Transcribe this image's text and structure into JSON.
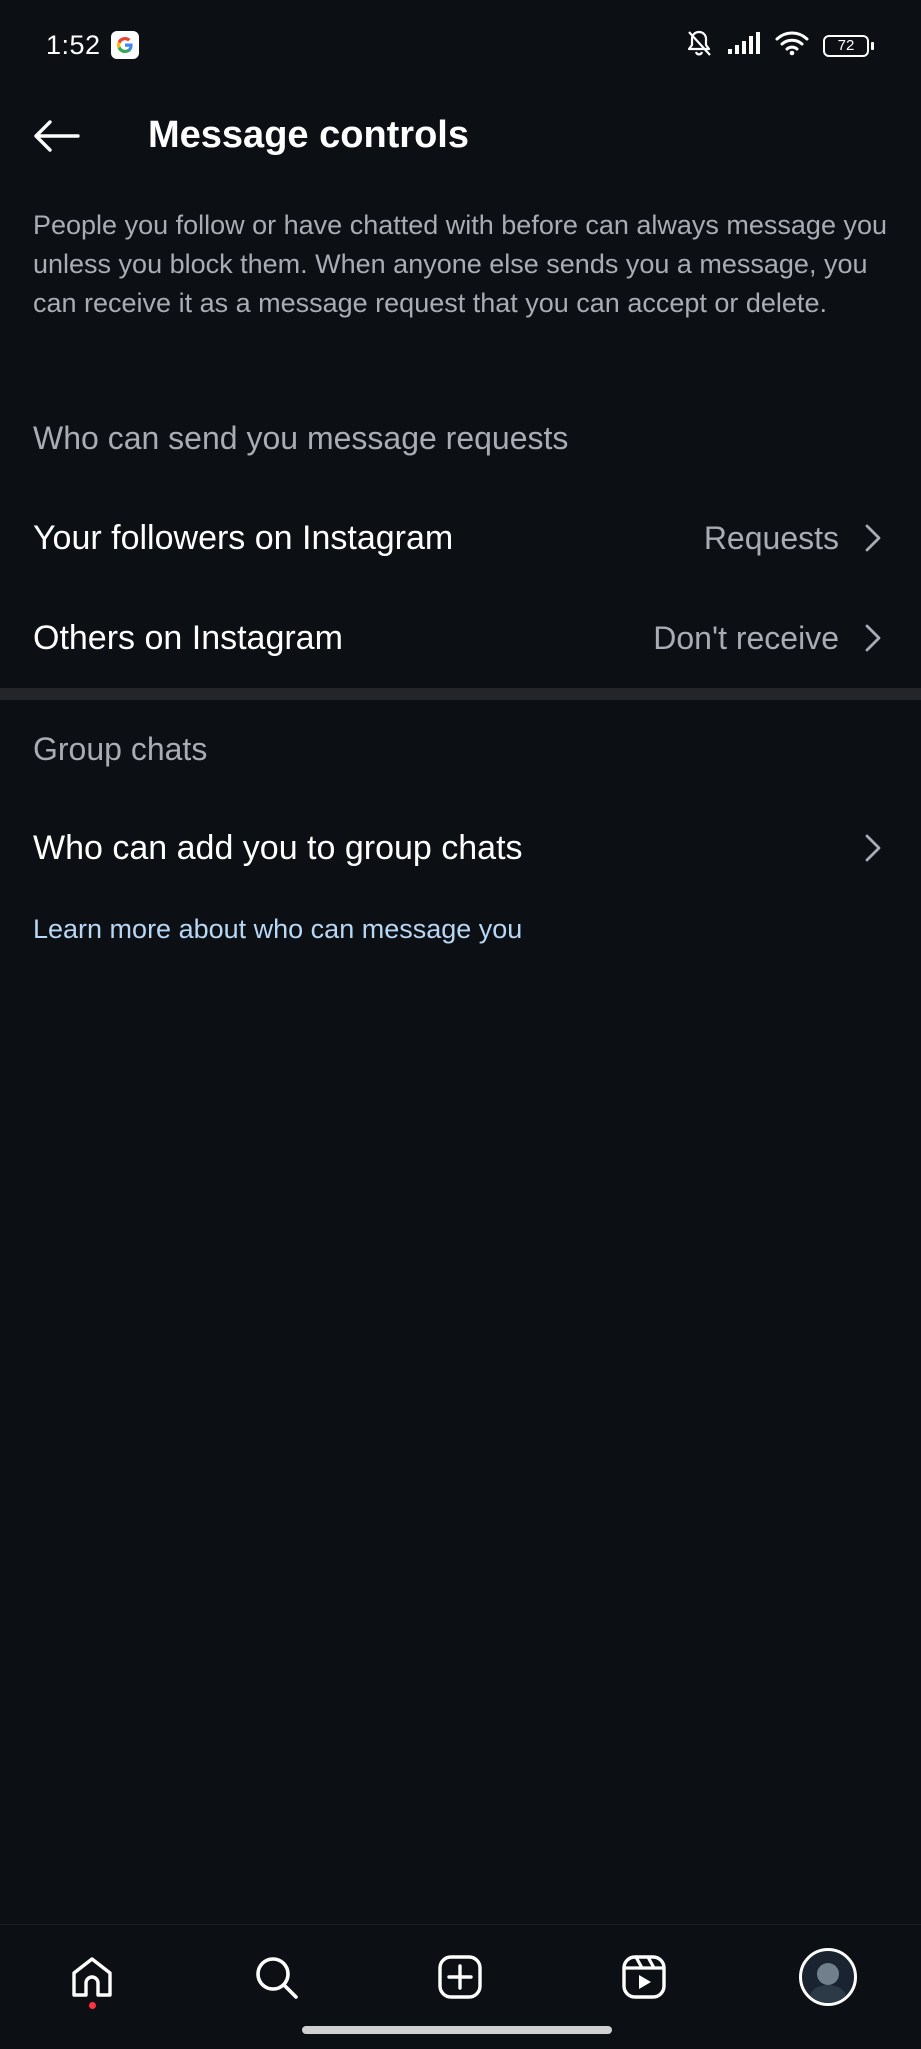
{
  "status_bar": {
    "time": "1:52",
    "battery": "72",
    "google_letter": "G"
  },
  "header": {
    "title": "Message controls"
  },
  "description": "People you follow or have chatted with before can always message you unless you block them. When anyone else sends you a message, you can receive it as a message request that you can accept or delete.",
  "section_requests": {
    "heading": "Who can send you message requests",
    "rows": [
      {
        "label": "Your followers on Instagram",
        "value": "Requests"
      },
      {
        "label": "Others on Instagram",
        "value": "Don't receive"
      }
    ]
  },
  "section_groups": {
    "heading": "Group chats",
    "rows": [
      {
        "label": "Who can add you to group chats",
        "value": ""
      }
    ]
  },
  "learn_more": "Learn more about who can message you",
  "nav": {
    "items": [
      "home-icon",
      "search-icon",
      "create-icon",
      "reels-icon",
      "profile-avatar"
    ]
  },
  "colors": {
    "background": "#0c0f14",
    "secondary_text": "#a8adb5",
    "link": "#b8d7f5",
    "notification_dot": "#ff3040"
  }
}
